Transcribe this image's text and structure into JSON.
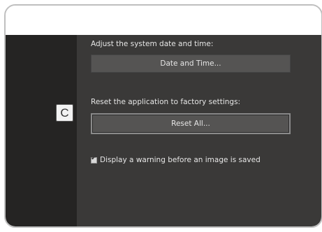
{
  "window": {},
  "settings": {
    "date_label": "Adjust the system date and time:",
    "date_button": "Date and Time...",
    "reset_label": "Reset the application to factory settings:",
    "reset_button": "Reset All...",
    "warning_checkbox": {
      "label": "Display a warning before an image is saved",
      "checked": true
    }
  },
  "callout": {
    "letter": "C"
  },
  "colors": {
    "sidebar": "#252423",
    "panel": "#3a3938",
    "button": "#555453",
    "text": "#e6e6e6"
  }
}
